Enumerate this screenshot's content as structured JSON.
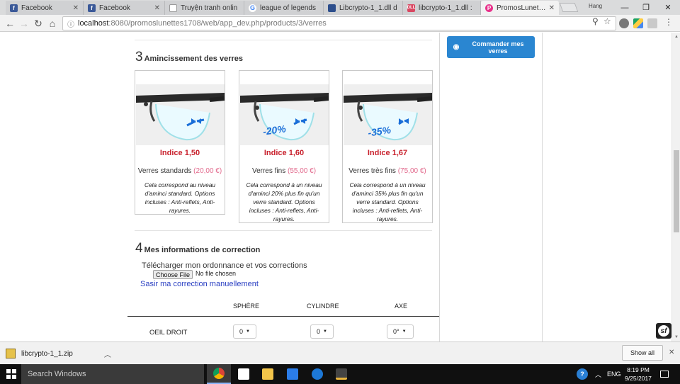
{
  "browser": {
    "tabs": [
      {
        "title": "Facebook",
        "icon": "facebook-icon"
      },
      {
        "title": "Facebook",
        "icon": "facebook-icon"
      },
      {
        "title": "Truyện tranh onlin",
        "icon": "document-icon"
      },
      {
        "title": "league of legends",
        "icon": "google-icon"
      },
      {
        "title": "Libcrypto-1_1.dll d",
        "icon": "library-icon"
      },
      {
        "title": "libcrypto-1_1.dll :",
        "icon": "dll-icon"
      },
      {
        "title": "PromosLunettes",
        "icon": "promoslunettes-icon"
      }
    ],
    "user": "Hang",
    "url_host": "localhost",
    "url_path": ":8080/promoslunettes1708/web/app_dev.php/products/3/verres"
  },
  "sidebar": {
    "order_button": "Commander mes verres"
  },
  "step3": {
    "number": "3",
    "title": "Amincissement des verres",
    "cards": [
      {
        "index": "Indice 1,50",
        "type": "Verres standards",
        "price": "(20,00 €)",
        "badge": "",
        "desc": "Cela correspond au niveau d'aminci standard. Options incluses : Anti-reflets, Anti-rayures."
      },
      {
        "index": "Indice 1,60",
        "type": "Verres fins",
        "price": "(55,00 €)",
        "badge": "-20%",
        "desc": "Cela correspond à un niveau d'aminci 20% plus fin qu'un verre standard. Options incluses : Anti-reflets, Anti-rayures."
      },
      {
        "index": "Indice 1,67",
        "type": "Verres très fins",
        "price": "(75,00 €)",
        "badge": "-35%",
        "desc": "Cela correspond à un niveau d'aminci 35% plus fin qu'un verre standard. Options incluses : Anti-reflets, Anti-rayures."
      }
    ]
  },
  "step4": {
    "number": "4",
    "title": "Mes informations de correction",
    "upload_label": "Télécharger mon ordonnance et vos corrections",
    "file_button": "Choose File",
    "file_status": "No file chosen",
    "manual_link": "Sasir ma correction manuellement",
    "columns": [
      "SPHÈRE",
      "CYLINDRE",
      "AXE"
    ],
    "row_label": "OEIL DROIT",
    "values": {
      "sphere": "0",
      "cylindre": "0",
      "axe": "0°"
    }
  },
  "downloads": {
    "file": "libcrypto-1_1.zip",
    "show_all": "Show all"
  },
  "taskbar": {
    "search_placeholder": "Search Windows",
    "language": "ENG",
    "time": "8:19 PM",
    "date": "9/25/2017"
  },
  "colors": {
    "accent": "#2a86d1",
    "index_red": "#c8202c",
    "price_pink": "#e26a8d",
    "link_blue": "#2a3fc2"
  }
}
